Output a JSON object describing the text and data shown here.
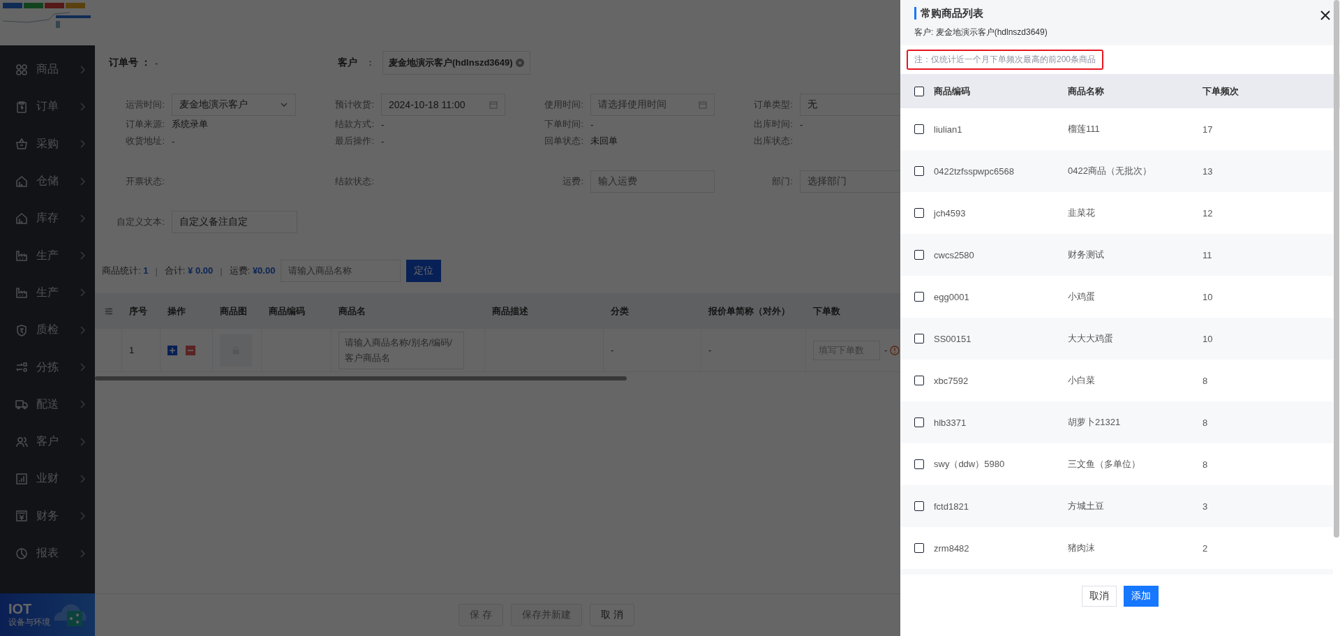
{
  "sidebar": {
    "items": [
      {
        "label": "商品"
      },
      {
        "label": "订单"
      },
      {
        "label": "采购"
      },
      {
        "label": "仓储"
      },
      {
        "label": "库存"
      },
      {
        "label": "生产"
      },
      {
        "label": "生产"
      },
      {
        "label": "质检"
      },
      {
        "label": "分拣"
      },
      {
        "label": "配送"
      },
      {
        "label": "客户"
      },
      {
        "label": "业财"
      },
      {
        "label": "财务"
      },
      {
        "label": "报表"
      }
    ],
    "promo": {
      "title": "IOT",
      "subtitle": "设备与环境"
    }
  },
  "order": {
    "order_no_label": "订单号 ：",
    "order_no": "-",
    "customer_label": "客户",
    "customer_sep": "：",
    "customer_tag": "麦金地演示客户(hdlnszd3649)"
  },
  "form": {
    "rows": [
      [
        {
          "kind": "select",
          "label": "运营时间:",
          "value": "麦金地演示客户"
        },
        {
          "kind": "date",
          "label": "预计收货:",
          "value": "2024-10-18 11:00"
        },
        {
          "kind": "date",
          "label": "使用时间:",
          "placeholder": "请选择使用时间"
        },
        {
          "kind": "input",
          "label": "订单类型:",
          "value": "无"
        }
      ],
      [
        {
          "kind": "text",
          "label": "订单来源:",
          "value": "系统录单"
        },
        {
          "kind": "text",
          "label": "结款方式:",
          "value": "-"
        },
        {
          "kind": "text",
          "label": "下单时间:",
          "value": "-"
        },
        {
          "kind": "text",
          "label": "出库时间:",
          "value": "-"
        }
      ],
      [
        {
          "kind": "text",
          "label": "收货地址:",
          "value": "-"
        },
        {
          "kind": "text",
          "label": "最后操作:",
          "value": "-"
        },
        {
          "kind": "text",
          "label": "回单状态:",
          "value": "未回单"
        },
        {
          "kind": "text",
          "label": "出库状态:"
        }
      ],
      [
        {
          "kind": "text",
          "label": "开票状态:"
        },
        {
          "kind": "text",
          "label": "结款状态:"
        },
        {
          "kind": "input",
          "label": "运费:",
          "placeholder": "输入运费"
        },
        {
          "kind": "input",
          "label": "部门:",
          "placeholder": "选择部门"
        }
      ],
      [
        {
          "kind": "input",
          "label": "自定义文本:",
          "value": "自定义备注自定"
        }
      ]
    ]
  },
  "toolbar": {
    "stats": [
      {
        "label": "商品统计:",
        "value": "1"
      },
      {
        "label": "合计:",
        "value": "¥ 0.00"
      },
      {
        "label": "运费:",
        "value": "¥0.00"
      }
    ],
    "separators": [
      "|",
      "|"
    ],
    "search_placeholder": "请输入商品名称",
    "locate_button": "定位"
  },
  "table": {
    "columns": [
      "序号",
      "操作",
      "商品图",
      "商品编码",
      "商品名",
      "商品描述",
      "分类",
      "报价单简称（对外）",
      "下单数"
    ],
    "rows": [
      {
        "index": "1",
        "name_placeholder": "请输入商品名称/别名/编码/客户商品名",
        "category": "-",
        "quote_name": "-",
        "qty_placeholder": "填写下单数",
        "qty_suffix": "-"
      }
    ]
  },
  "footer": {
    "buttons": [
      {
        "label": "保 存",
        "disabled": true
      },
      {
        "label": "保存并新建",
        "disabled": true
      },
      {
        "label": "取 消",
        "disabled": false
      }
    ]
  },
  "drawer": {
    "title": "常购商品列表",
    "customer": "客户: 麦金地演示客户(hdlnszd3649)",
    "note": "注：仅统计近一个月下单频次最高的前200条商品",
    "select_all_checked": false,
    "columns": [
      "商品编码",
      "商品名称",
      "下单频次"
    ],
    "rows": [
      {
        "code": "liulian1",
        "name": "榴莲111",
        "frequency": "17",
        "checked": false
      },
      {
        "code": "0422tzfsspwpc6568",
        "name": "0422商品（无批次）",
        "frequency": "13",
        "checked": false
      },
      {
        "code": "jch4593",
        "name": "韭菜花",
        "frequency": "12",
        "checked": false
      },
      {
        "code": "cwcs2580",
        "name": "财务测试",
        "frequency": "11",
        "checked": false
      },
      {
        "code": "egg0001",
        "name": "小鸡蛋",
        "frequency": "10",
        "checked": false
      },
      {
        "code": "SS00151",
        "name": "大大大鸡蛋",
        "frequency": "10",
        "checked": false
      },
      {
        "code": "xbc7592",
        "name": "小白菜",
        "frequency": "8",
        "checked": false
      },
      {
        "code": "hlb3371",
        "name": "胡萝卜21321",
        "frequency": "8",
        "checked": false
      },
      {
        "code": "swy（ddw）5980",
        "name": "三文鱼（多单位）",
        "frequency": "8",
        "checked": false
      },
      {
        "code": "fctd1821",
        "name": "方城土豆",
        "frequency": "3",
        "checked": false
      },
      {
        "code": "zrm8482",
        "name": "猪肉沫",
        "frequency": "2",
        "checked": false
      }
    ],
    "buttons": [
      {
        "label": "取消",
        "kind": "default"
      },
      {
        "label": "添加",
        "kind": "primary"
      }
    ]
  }
}
